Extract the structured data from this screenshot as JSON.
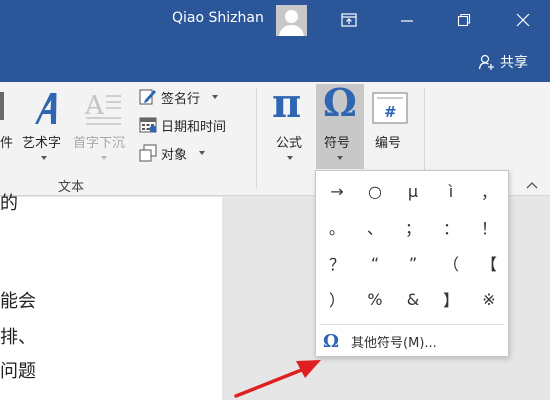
{
  "titlebar": {
    "user_name": "Qiao Shizhan",
    "share_label": "共享"
  },
  "ribbon": {
    "partial_label": "件",
    "wordart_label": "艺术字",
    "dropcap_label": "首字下沉",
    "signature_line_label": "签名行",
    "datetime_label": "日期和时间",
    "object_label": "对象",
    "text_group_label": "文本",
    "equation_label": "公式",
    "symbol_label": "符号",
    "number_label": "编号",
    "equation_icon": "π",
    "symbol_icon": "Ω"
  },
  "document": {
    "lines": [
      "的",
      "能会",
      "排、",
      "问题"
    ]
  },
  "symbol_dropdown": {
    "symbols": [
      "→",
      "○",
      "μ",
      "ì",
      "，",
      "。",
      "、",
      "；",
      "：",
      "！",
      "？",
      "“",
      "”",
      "（",
      "【",
      "）",
      "%",
      "&",
      "】",
      "※"
    ],
    "more_symbols_label": "其他符号(M)...",
    "more_symbols_icon": "Ω"
  },
  "colors": {
    "titlebar": "#2b579a",
    "accent": "#2e66b2",
    "arrow": "#e02020"
  }
}
